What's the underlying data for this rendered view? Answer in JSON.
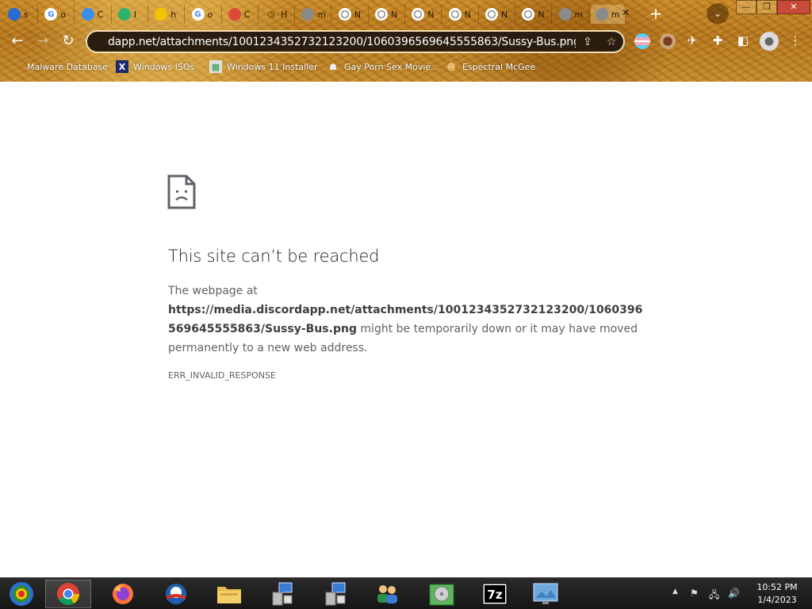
{
  "tabs": [
    {
      "label": "s",
      "icon": "blue-feather-icon",
      "color": "#2a6bd4"
    },
    {
      "label": "o",
      "icon": "google-icon",
      "color": "#ffffff"
    },
    {
      "label": "C",
      "icon": "blue-badge-icon",
      "color": "#3b8ee8"
    },
    {
      "label": "I",
      "icon": "green-chart-icon",
      "color": "#2fb36b"
    },
    {
      "label": "h",
      "icon": "mask-icon",
      "color": "#f2c400"
    },
    {
      "label": "o",
      "icon": "google-icon",
      "color": "#ffffff"
    },
    {
      "label": "C",
      "icon": "red-notification-icon",
      "color": "#e0483a"
    },
    {
      "label": "H",
      "icon": "history-icon",
      "color": "#ffffff"
    },
    {
      "label": "m",
      "icon": "globe-icon",
      "color": "#8a8a8a"
    },
    {
      "label": "N",
      "icon": "chrome-icon",
      "color": "#ffffff"
    },
    {
      "label": "N",
      "icon": "chrome-icon",
      "color": "#ffffff"
    },
    {
      "label": "N",
      "icon": "chrome-icon",
      "color": "#ffffff"
    },
    {
      "label": "N",
      "icon": "chrome-icon",
      "color": "#ffffff"
    },
    {
      "label": "N",
      "icon": "chrome-icon",
      "color": "#ffffff"
    },
    {
      "label": "N",
      "icon": "chrome-icon",
      "color": "#ffffff"
    },
    {
      "label": "m",
      "icon": "globe-icon",
      "color": "#8a8a8a"
    },
    {
      "label": "m",
      "icon": "blank-icon",
      "color": "#8a8a8a"
    }
  ],
  "toolbar": {
    "url": "dapp.net/attachments/1001234352732123200/1060396569645555863/Sussy-Bus.png"
  },
  "bookmarks": [
    {
      "label": "Malware Database",
      "icon": "bookmark-icon"
    },
    {
      "label": "Windows ISOs",
      "icon": "x-logo-icon"
    },
    {
      "label": "Windows 11 Installer",
      "icon": "image-icon"
    },
    {
      "label": "Gay Porn Sex Movie...",
      "icon": "robot-icon"
    },
    {
      "label": "Espectral McGee",
      "icon": "character-icon"
    }
  ],
  "error": {
    "title": "This site can’t be reached",
    "intro": "The webpage at",
    "url": "https://media.discordapp.net/attachments/1001234352732123200/1060396569645555863/Sussy-Bus.png",
    "rest": " might be temporarily down or it may have moved permanently to a new web address.",
    "code": "ERR_INVALID_RESPONSE"
  },
  "taskbar": {
    "time": "10:52 PM",
    "date": "1/4/2023",
    "apps": [
      "chrome-app",
      "firefox-app",
      "obama-app",
      "file-explorer-app",
      "network-setup-app",
      "network-setup-app-2",
      "users-app",
      "disk-app",
      "sevenzip-app",
      "display-app"
    ]
  },
  "colors": {
    "accent": "#1a73e8",
    "chrome_bg": "#b4761d",
    "error_title": "#202124",
    "error_text": "#5f6368"
  }
}
